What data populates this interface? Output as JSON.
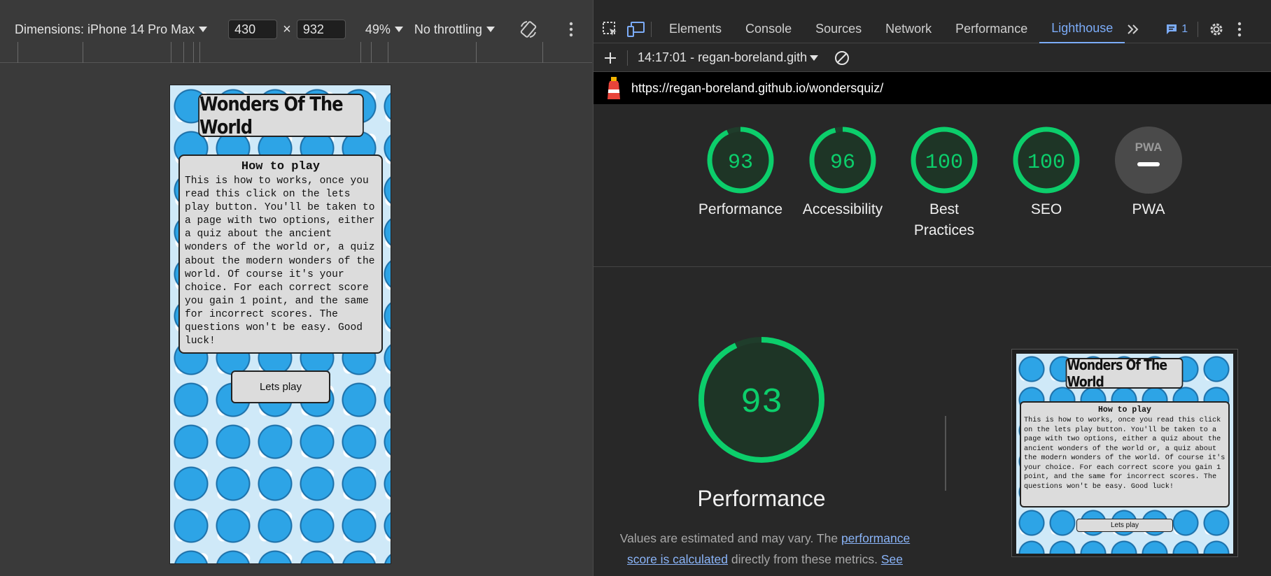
{
  "device_toolbar": {
    "dimensions_label": "Dimensions: iPhone 14 Pro Max",
    "width": "430",
    "height": "932",
    "times": "×",
    "zoom": "49%",
    "throttling": "No throttling"
  },
  "preview_page": {
    "title": "Wonders Of The World",
    "card_heading": "How to play",
    "card_text": "This is how to works, once you read this click on the lets play button. You'll be taken to a page with two options, either a quiz about the ancient wonders of the world or, a quiz about the modern wonders of the world. Of course it's your choice. For each correct score you gain 1 point, and the same for incorrect scores. The questions won't be easy. Good luck!",
    "button_label": "Lets play"
  },
  "devtools": {
    "tabs": [
      {
        "label": "Elements"
      },
      {
        "label": "Console"
      },
      {
        "label": "Sources"
      },
      {
        "label": "Network"
      },
      {
        "label": "Performance"
      },
      {
        "label": "Lighthouse"
      }
    ],
    "active_tab": "Lighthouse",
    "issues_count": "1",
    "report_selector": "14:17:01 - regan-boreland.gith",
    "url": "https://regan-boreland.github.io/wondersquiz/"
  },
  "scores": [
    {
      "value": "93",
      "label": "Performance",
      "fraction": 0.93
    },
    {
      "value": "96",
      "label": "Accessibility",
      "fraction": 0.96
    },
    {
      "value": "100",
      "label": "Best Practices",
      "fraction": 1.0
    },
    {
      "value": "100",
      "label": "SEO",
      "fraction": 1.0
    }
  ],
  "pwa": {
    "label": "PWA",
    "badge": "PWA"
  },
  "performance_section": {
    "score": "93",
    "fraction": 0.93,
    "title": "Performance",
    "desc_prefix": "Values are estimated and may vary. The ",
    "desc_link1": "performance score is calculated",
    "desc_mid": " directly from these metrics. ",
    "desc_link2": "See"
  },
  "colors": {
    "pass_green": "#0cce6b",
    "accent_blue": "#7cacf8"
  }
}
